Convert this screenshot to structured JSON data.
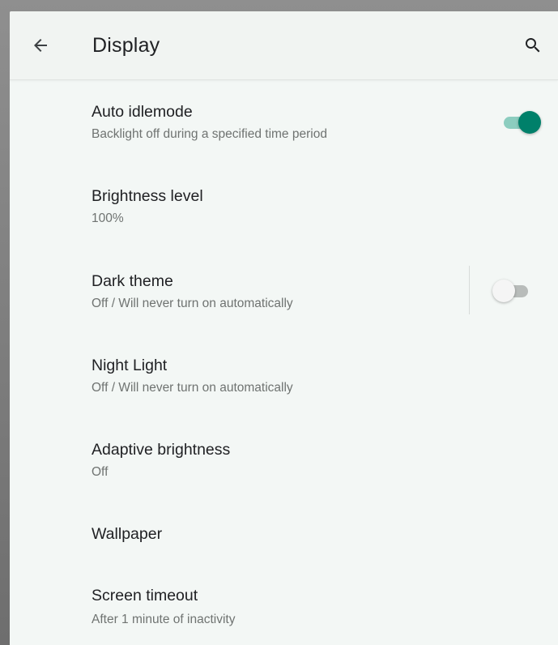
{
  "app_bar": {
    "title": "Display",
    "back_icon": "arrow-left-icon",
    "search_icon": "search-icon"
  },
  "preferences": [
    {
      "title": "Auto idlemode",
      "summary": "Backlight off during a specified time period",
      "switch": "on"
    },
    {
      "title": "Brightness level",
      "summary": "100%"
    },
    {
      "title": "Dark theme",
      "summary": "Off / Will never turn on automatically",
      "switch": "off"
    },
    {
      "title": "Night Light",
      "summary": "Off / Will never turn on automatically"
    },
    {
      "title": "Adaptive brightness",
      "summary": "Off"
    },
    {
      "title": "Wallpaper",
      "summary": ""
    },
    {
      "title": "Screen timeout",
      "summary": "After 1 minute of inactivity"
    }
  ],
  "colors": {
    "accent": "#00806a",
    "accent_track": "#8ccdbf",
    "background": "#f3f7f5",
    "text_primary": "#202124",
    "text_secondary": "#6f7371"
  }
}
